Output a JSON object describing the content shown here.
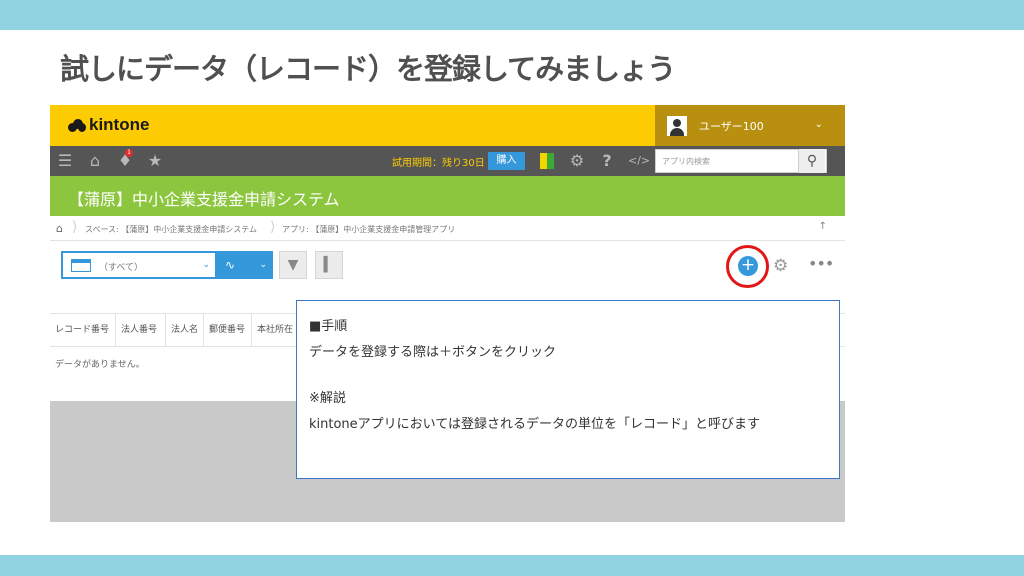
{
  "slide": {
    "title": "試しにデータ（レコード）を登録してみましょう"
  },
  "header": {
    "logo": "kintone",
    "user": "ユーザー100"
  },
  "navbar": {
    "notification_count": "1",
    "trial": "試用期間：残り30日",
    "buy": "購入",
    "search_placeholder": "アプリ内検索"
  },
  "app": {
    "title": "【蒲原】中小企業支援金申請システム"
  },
  "breadcrumb": {
    "space": "スペース: 【蒲原】中小企業支援金申請システム",
    "app": "アプリ: 【蒲原】中小企業支援金申請管理アプリ"
  },
  "toolbar": {
    "view": "（すべて）"
  },
  "table": {
    "columns": [
      "レコード番号",
      "法人番号",
      "法人名",
      "郵便番号",
      "本社所在"
    ],
    "empty_message": "データがありません。"
  },
  "callout": {
    "heading": "■手順",
    "step": "データを登録する際は＋ボタンをクリック",
    "note_heading": "※解説",
    "note": "kintoneアプリにおいては登録されるデータの単位を「レコード」と呼びます"
  },
  "colors": {
    "band": "#92d3e2",
    "header_yellow": "#fccb01",
    "nav_gray": "#555555",
    "app_green": "#8cc63f",
    "accent_blue": "#3498db",
    "highlight_red": "#e01818"
  }
}
